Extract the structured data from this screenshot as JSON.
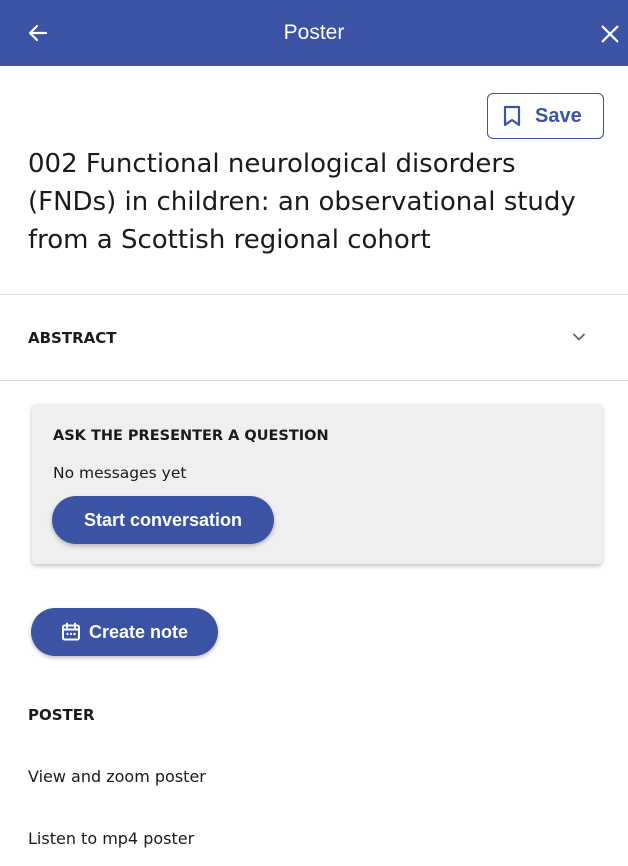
{
  "appbar": {
    "title": "Poster",
    "back_icon": "arrow-left-icon",
    "close_icon": "close-icon"
  },
  "save": {
    "label": "Save",
    "icon": "bookmark-icon"
  },
  "poster_title": "002 Functional neurological disorders (FNDs) in children: an observational study from a Scottish regional cohort",
  "abstract": {
    "label": "ABSTRACT",
    "icon": "chevron-down-icon"
  },
  "question_card": {
    "heading": "ASK THE PRESENTER A QUESTION",
    "empty_text": "No messages yet",
    "button_label": "Start conversation"
  },
  "note": {
    "label": "Create note",
    "icon": "calendar-icon"
  },
  "poster_section": {
    "label": "POSTER",
    "links": [
      "View and zoom poster",
      "Listen to mp4 poster"
    ]
  },
  "colors": {
    "brand": "#3a53a4",
    "card_bg": "#efefef",
    "divider": "#dcdcdc"
  }
}
